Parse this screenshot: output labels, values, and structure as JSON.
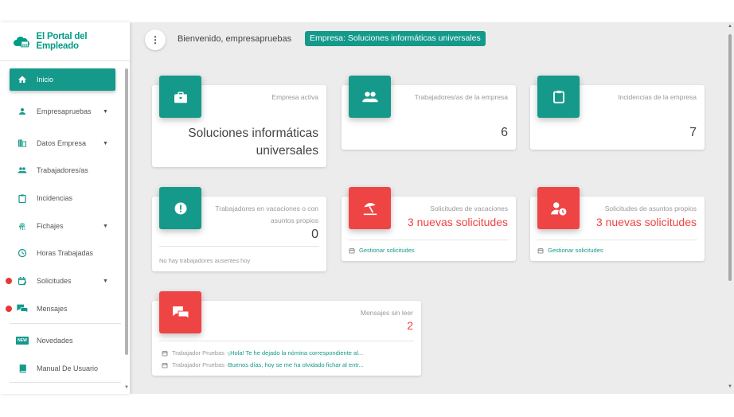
{
  "app": {
    "title": "El Portal del Empleado"
  },
  "sidebar": {
    "items": [
      {
        "label": "Inicio",
        "icon": "home-icon",
        "active": true
      },
      {
        "label": "Empresapruebas",
        "icon": "person-icon",
        "has_caret": true
      },
      {
        "label": "Datos Empresa",
        "icon": "building-icon",
        "has_caret": true
      },
      {
        "label": "Trabajadores/as",
        "icon": "people-icon"
      },
      {
        "label": "Incidencias",
        "icon": "clipboard-icon"
      },
      {
        "label": "Fichajes",
        "icon": "fingerprint-icon",
        "has_caret": true
      },
      {
        "label": "Horas Trabajadas",
        "icon": "clock-icon"
      },
      {
        "label": "Solicitudes",
        "icon": "calendar-edit-icon",
        "has_caret": true,
        "notification": true
      },
      {
        "label": "Mensajes",
        "icon": "chat-icon",
        "notification": true
      },
      {
        "label": "Novedades",
        "icon": "new-badge-icon"
      },
      {
        "label": "Manual De Usuario",
        "icon": "book-icon"
      }
    ],
    "new_badge_text": "NEW"
  },
  "header": {
    "menu_icon": "more-vert-icon",
    "welcome": "Bienvenido, empresapruebas",
    "company": "Empresa: Soluciones informáticas universales"
  },
  "cards": {
    "empresa_activa": {
      "title": "Empresa activa",
      "value_line1": "Soluciones informáticas",
      "value_line2": "universales",
      "icon": "briefcase-icon"
    },
    "trabajadores": {
      "title": "Trabajadores/as de la empresa",
      "value": "6",
      "icon": "people-icon"
    },
    "incidencias": {
      "title": "Incidencias de la empresa",
      "value": "7",
      "icon": "clipboard-icon"
    },
    "vacaciones_ausentes": {
      "title_line1": "Trabajadores en vacaciones o con",
      "title_line2": "asuntos propios",
      "value": "0",
      "footer": "No hay trabajadores ausentes hoy",
      "icon": "alert-icon"
    },
    "solicitudes_vacaciones": {
      "title": "Solicitudes de vacaciones",
      "value": "3 nuevas solicitudes",
      "footer_link": "Gestionar solicitudes",
      "icon": "beach-icon"
    },
    "solicitudes_asuntos": {
      "title": "Solicitudes de asuntos propios",
      "value": "3 nuevas solicitudes",
      "footer_link": "Gestionar solicitudes",
      "icon": "person-clock-icon"
    },
    "mensajes": {
      "title": "Mensajes sin leer",
      "value": "2",
      "icon": "chat-icon",
      "messages": [
        {
          "from": "Trabajador Pruebas - ",
          "text": "¡Hola! Te he dejado la nómina correspondiente al..."
        },
        {
          "from": "Trabajador Pruebas - ",
          "text": "Buenos días, hoy se me ha olvidado fichar al entr..."
        }
      ]
    }
  },
  "colors": {
    "accent": "#14998a",
    "alert": "#ef4444",
    "notification": "#e53935"
  }
}
